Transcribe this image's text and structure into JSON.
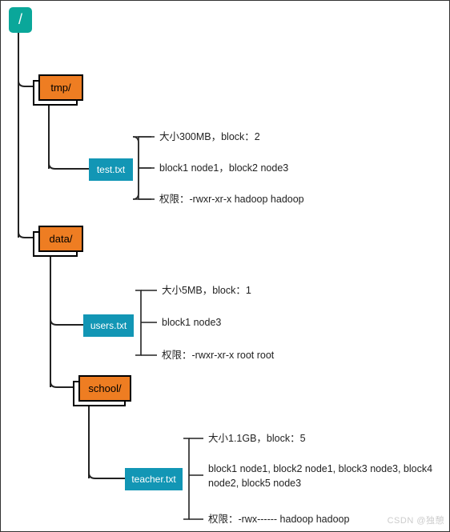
{
  "root": {
    "label": "/"
  },
  "tmp": {
    "label": "tmp/",
    "file": {
      "label": "test.txt"
    },
    "info": {
      "size": "大小300MB，block：2",
      "blocks": "block1 node1，block2 node3",
      "perm": "权限：-rwxr-xr-x hadoop hadoop"
    }
  },
  "data": {
    "label": "data/",
    "users": {
      "label": "users.txt",
      "info": {
        "size": "大小5MB，block：1",
        "blocks": "block1 node3",
        "perm": "权限：-rwxr-xr-x root root"
      }
    },
    "school": {
      "label": "school/",
      "teacher": {
        "label": "teacher.txt",
        "info": {
          "size": "大小1.1GB，block：5",
          "blocks": "block1 node1, block2 node1, block3 node3, block4 node2, block5 node3",
          "perm": "权限：-rwx------ hadoop hadoop"
        }
      }
    }
  },
  "watermark": "CSDN @独憩",
  "colors": {
    "root": "#0aa79a",
    "folder": "#ee7d22",
    "file": "#1296b5",
    "line": "#222"
  }
}
